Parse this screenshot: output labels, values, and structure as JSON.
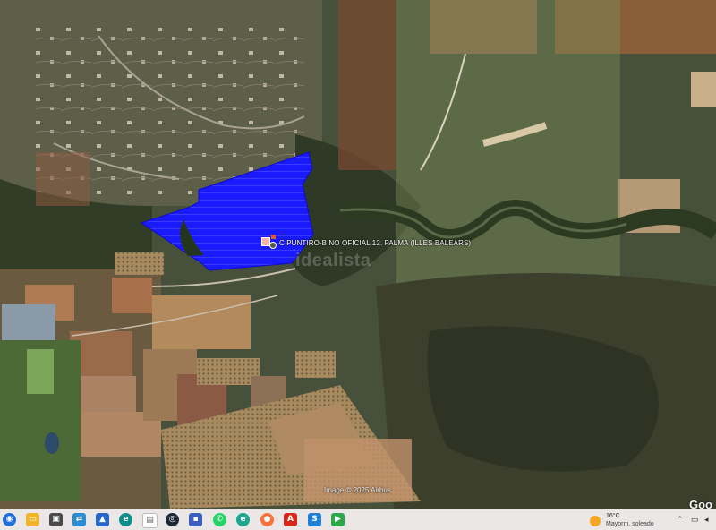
{
  "map": {
    "poi_label": "C PUNTIRO-B NO OFICIAL 12. PALMA (ILLES BALEARS)",
    "watermark": "idealista",
    "copyright": "Image © 2025 Airbus",
    "corner_logo": "Goo"
  },
  "taskbar": {
    "icons": [
      "start-icon",
      "file-manager-icon",
      "window-icon",
      "network-icon",
      "photos-icon",
      "edge-icon",
      "document-icon",
      "steam-icon",
      "save-icon",
      "whatsapp-icon",
      "edge-alt-icon",
      "firefox-icon",
      "acrobat-icon",
      "app-s-icon",
      "app-green-icon"
    ],
    "weather": {
      "temperature": "16°C",
      "description": "Mayorm. soleado"
    }
  }
}
